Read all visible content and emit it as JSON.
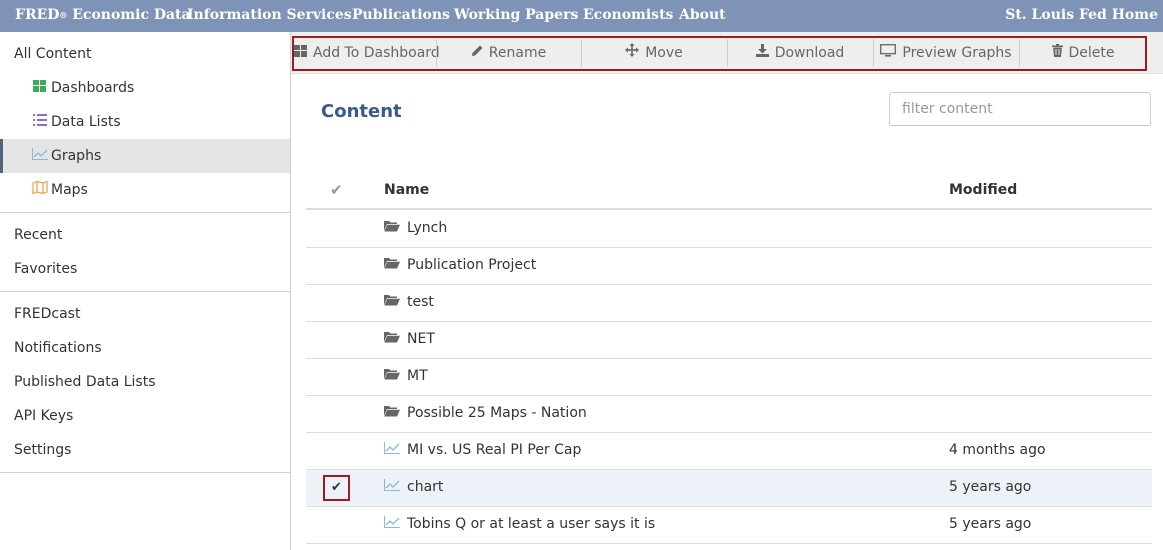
{
  "topnav": {
    "brand": "FRED",
    "brand_reg": "®",
    "brand_rest": "Economic Data",
    "items": [
      "Information Services",
      "Publications",
      "Working Papers",
      "Economists",
      "About"
    ],
    "home": "St. Louis Fed Home"
  },
  "sidebar": {
    "all_content": "All Content",
    "sub_items": [
      {
        "label": "Dashboards",
        "icon": "dashboard-grid-icon"
      },
      {
        "label": "Data Lists",
        "icon": "list-icon"
      },
      {
        "label": "Graphs",
        "icon": "line-chart-icon"
      },
      {
        "label": "Maps",
        "icon": "map-icon"
      }
    ],
    "active": "Graphs",
    "group2": [
      "Recent",
      "Favorites"
    ],
    "group3": [
      "FREDcast",
      "Notifications",
      "Published Data Lists",
      "API Keys",
      "Settings"
    ]
  },
  "toolbar": {
    "add_to_dashboard": "Add To Dashboard",
    "rename": "Rename",
    "move": "Move",
    "download": "Download",
    "preview_graphs": "Preview Graphs",
    "delete": "Delete"
  },
  "content": {
    "title": "Content",
    "filter_placeholder": "filter content"
  },
  "table": {
    "columns": {
      "name": "Name",
      "modified": "Modified"
    },
    "rows": [
      {
        "type": "folder",
        "name": "Lynch",
        "modified": ""
      },
      {
        "type": "folder",
        "name": "Publication Project",
        "modified": ""
      },
      {
        "type": "folder",
        "name": "test",
        "modified": ""
      },
      {
        "type": "folder",
        "name": "NET",
        "modified": ""
      },
      {
        "type": "folder",
        "name": "MT",
        "modified": ""
      },
      {
        "type": "folder",
        "name": "Possible 25 Maps - Nation",
        "modified": ""
      },
      {
        "type": "graph",
        "name": "MI vs. US Real PI Per Cap",
        "modified": "4 months ago"
      },
      {
        "type": "graph",
        "name": "chart",
        "modified": "5 years ago",
        "selected": true
      },
      {
        "type": "graph",
        "name": "Tobins Q or at least a user says it is",
        "modified": "5 years ago"
      }
    ]
  },
  "colors": {
    "topnav_bg": "#7f93b7",
    "title_blue": "#3a5a8c",
    "highlight_red": "#9b1c22",
    "dashboard_icon": "#3aaa5c",
    "list_icon": "#8a6fc4",
    "graph_icon": "#8ab8d8",
    "map_icon": "#f0a040"
  }
}
